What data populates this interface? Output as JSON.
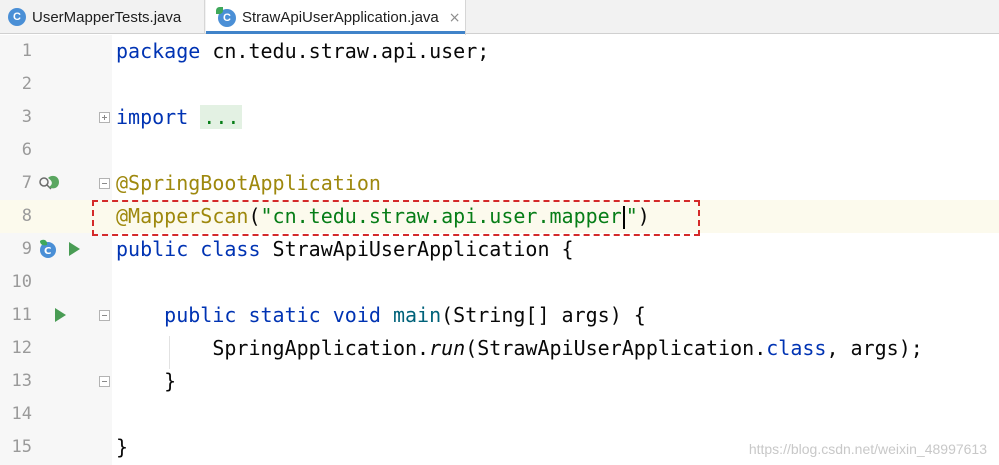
{
  "tabs": [
    {
      "label": "UserMapperTests.java",
      "icon": "java-class-test-icon",
      "active": false
    },
    {
      "label": "StrawApiUserApplication.java",
      "icon": "java-class-spring-icon",
      "active": true,
      "close": "×"
    }
  ],
  "code": {
    "line_numbers": [
      "1",
      "2",
      "3",
      "6",
      "7",
      "8",
      "9",
      "10",
      "11",
      "12",
      "13",
      "14",
      "15"
    ],
    "l1": {
      "kw": "package",
      "rest": " cn.tedu.straw.api.user;"
    },
    "l3": {
      "kw": "import",
      "dots": "..."
    },
    "l7": {
      "ann": "@SpringBootApplication"
    },
    "l8": {
      "ann": "@MapperScan",
      "open": "(",
      "str_a": "\"cn.tedu.straw.api.user.mapper",
      "str_b": "\"",
      "close": ")"
    },
    "l9": {
      "kw": "public class",
      "rest": " StrawApiUserApplication {"
    },
    "l11": {
      "indent": "    ",
      "kw": "public static void",
      "sp": " ",
      "fn": "main",
      "rest": "(String[] args) {"
    },
    "l12": {
      "indent": "        ",
      "pre": "SpringApplication.",
      "it": "run",
      "mid": "(StrawApiUserApplication.",
      "kw": "class",
      "rest": ", args);"
    },
    "l13": {
      "text": "    }"
    },
    "l15": {
      "text": "}"
    }
  },
  "watermark": "https://blog.csdn.net/weixin_48997613",
  "colors": {
    "keyword": "#0033b3",
    "annotation": "#9e880d",
    "string": "#067d17",
    "highlight_box": "#d42a2a"
  }
}
